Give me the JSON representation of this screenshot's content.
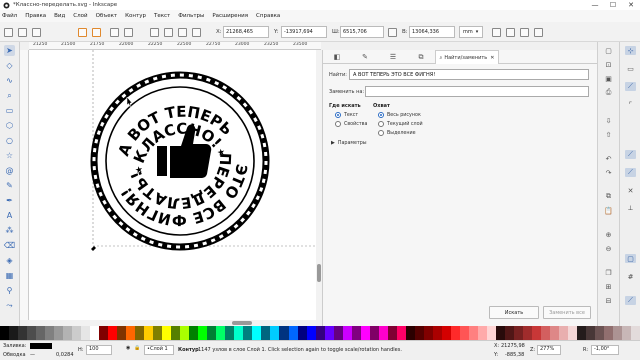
{
  "window": {
    "title": "*Классно-переделать.svg - Inkscape",
    "minimize": "—",
    "maximize": "☐",
    "close": "✕"
  },
  "menu": [
    "Файл",
    "Правка",
    "Вид",
    "Слой",
    "Объект",
    "Контур",
    "Текст",
    "Фильтры",
    "Расширения",
    "Справка"
  ],
  "controls": {
    "x_label": "X:",
    "x_value": "21268,465",
    "y_label": "Y:",
    "y_value": "-13917,694",
    "w_label": "Ш:",
    "w_value": "6515,706",
    "h_label": "В:",
    "h_value": "13064,336",
    "unit": "mm"
  },
  "ruler_top": [
    "21250",
    "21500",
    "21750",
    "22000",
    "22250",
    "22500",
    "22750",
    "23000",
    "23250",
    "23500"
  ],
  "stamp": {
    "line1": "А ВОТ ТЕПЕРЬ",
    "line2": "КЛАССНО!",
    "line3": "ЭТО ВСЕ ФИГНЯ!",
    "line4": "ПЕРЕДЕЛАТЬ!"
  },
  "dialog": {
    "tab_title": "Найти/заменить",
    "find_label": "Найти:",
    "find_value": "А ВОТ ТЕПЕРЬ       ЭТО ВСЕ ФИГНЯ!",
    "replace_label": "Заменить на:",
    "replace_value": "",
    "search_in_title": "Где искать",
    "search_in_options": [
      "Текст",
      "Свойства"
    ],
    "scope_title": "Охват",
    "scope_options": [
      "Весь рисунок",
      "Текущий слой",
      "Выделение"
    ],
    "params_label": "Параметры",
    "find_button": "Искать",
    "replace_all_button": "Заменить все"
  },
  "palette": [
    "#000000",
    "#1a1a1a",
    "#333333",
    "#4d4d4d",
    "#666666",
    "#808080",
    "#999999",
    "#b3b3b3",
    "#cccccc",
    "#e6e6e6",
    "#ffffff",
    "#800000",
    "#ff0000",
    "#803300",
    "#ff6600",
    "#806600",
    "#ffcc00",
    "#808000",
    "#ffff00",
    "#558000",
    "#aaff00",
    "#008000",
    "#00ff00",
    "#008033",
    "#00ff66",
    "#008066",
    "#00ffcc",
    "#008080",
    "#00ffff",
    "#006680",
    "#00ccff",
    "#003380",
    "#0066ff",
    "#000080",
    "#0000ff",
    "#330080",
    "#6600ff",
    "#660080",
    "#cc00ff",
    "#800080",
    "#ff00ff",
    "#800066",
    "#ff00cc",
    "#800033",
    "#ff0066",
    "#2b0000",
    "#550000",
    "#800000",
    "#aa0000",
    "#d40000",
    "#ff2a2a",
    "#ff5555",
    "#ff8080",
    "#ffaaaa",
    "#ffd5d5",
    "#280b0b",
    "#501616",
    "#782121",
    "#a02c2c",
    "#c83737",
    "#d35f5f",
    "#de8787",
    "#e9afaf",
    "#f4d7d7",
    "#241c1c",
    "#483737",
    "#6c5353",
    "#916f6f",
    "#ac9393",
    "#c8b7b7",
    "#e3dbdb"
  ],
  "status": {
    "fill_label": "Заливка:",
    "stroke_label": "Обводка",
    "stroke_width": "0,0284",
    "opacity_label": "Н:",
    "opacity_value": "100",
    "layer": "•Слой 1",
    "message_bold": "Контур",
    "message": " 1147 узлов в слое Слой 1. Click selection again to toggle scale/rotation handles.",
    "cursor_x_label": "X:",
    "cursor_x": "21275,98",
    "cursor_y_label": "Y:",
    "cursor_y": "-885,38",
    "zoom_label": "Z:",
    "zoom": "277%",
    "rotation_label": "R:",
    "rotation": "-1,00°"
  }
}
